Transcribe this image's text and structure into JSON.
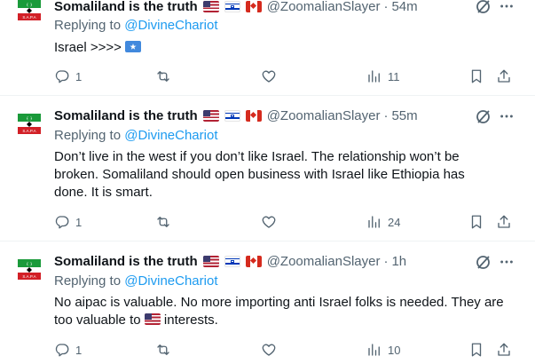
{
  "tweets": [
    {
      "display_name": "Somaliland is the truth",
      "handle": "@ZoomalianSlayer",
      "time": "54m",
      "replying_prefix": "Replying to ",
      "replying_to": "@DivineChariot",
      "text": "Israel >>>>",
      "replies": "1",
      "reposts": "",
      "likes": "",
      "views": "11"
    },
    {
      "display_name": "Somaliland is the truth",
      "handle": "@ZoomalianSlayer",
      "time": "55m",
      "replying_prefix": "Replying to ",
      "replying_to": "@DivineChariot",
      "text": "Don’t live in the west if you don’t like Israel. The relationship won’t be broken. Somaliland should open business with Israel like Ethiopia has done. It is smart.",
      "replies": "1",
      "reposts": "",
      "likes": "",
      "views": "24"
    },
    {
      "display_name": "Somaliland is the truth",
      "handle": "@ZoomalianSlayer",
      "time": "1h",
      "replying_prefix": "Replying to ",
      "replying_to": "@DivineChariot",
      "text_before_flag": "No aipac is valuable. No more importing anti Israel folks is needed. They are too valuable to",
      "text_after_flag": " interests.",
      "replies": "1",
      "reposts": "",
      "likes": "",
      "views": "10"
    }
  ],
  "avatar_text": "S.A.P.A",
  "icons": {
    "reply": "reply-icon",
    "repost": "repost-icon",
    "like": "heart-icon",
    "views": "views-icon",
    "bookmark": "bookmark-icon",
    "share": "share-icon",
    "grok": "grok-icon",
    "more": "more-icon"
  },
  "colors": {
    "link": "#1d9bf0",
    "secondary": "#536471",
    "text": "#0f1419"
  }
}
